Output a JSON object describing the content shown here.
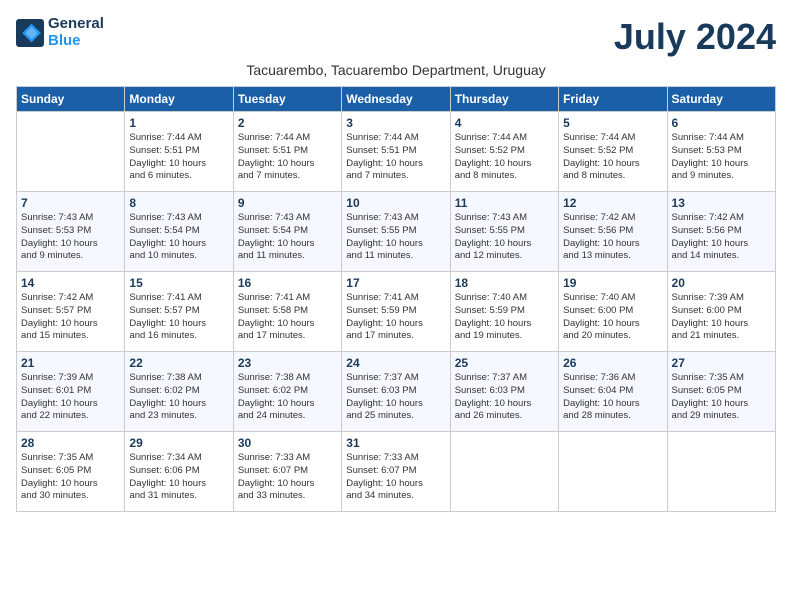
{
  "header": {
    "logo_line1": "General",
    "logo_line2": "Blue",
    "month_year": "July 2024",
    "location": "Tacuarembo, Tacuarembo Department, Uruguay"
  },
  "days_of_week": [
    "Sunday",
    "Monday",
    "Tuesday",
    "Wednesday",
    "Thursday",
    "Friday",
    "Saturday"
  ],
  "weeks": [
    [
      {
        "num": "",
        "info": ""
      },
      {
        "num": "1",
        "info": "Sunrise: 7:44 AM\nSunset: 5:51 PM\nDaylight: 10 hours\nand 6 minutes."
      },
      {
        "num": "2",
        "info": "Sunrise: 7:44 AM\nSunset: 5:51 PM\nDaylight: 10 hours\nand 7 minutes."
      },
      {
        "num": "3",
        "info": "Sunrise: 7:44 AM\nSunset: 5:51 PM\nDaylight: 10 hours\nand 7 minutes."
      },
      {
        "num": "4",
        "info": "Sunrise: 7:44 AM\nSunset: 5:52 PM\nDaylight: 10 hours\nand 8 minutes."
      },
      {
        "num": "5",
        "info": "Sunrise: 7:44 AM\nSunset: 5:52 PM\nDaylight: 10 hours\nand 8 minutes."
      },
      {
        "num": "6",
        "info": "Sunrise: 7:44 AM\nSunset: 5:53 PM\nDaylight: 10 hours\nand 9 minutes."
      }
    ],
    [
      {
        "num": "7",
        "info": "Sunrise: 7:43 AM\nSunset: 5:53 PM\nDaylight: 10 hours\nand 9 minutes."
      },
      {
        "num": "8",
        "info": "Sunrise: 7:43 AM\nSunset: 5:54 PM\nDaylight: 10 hours\nand 10 minutes."
      },
      {
        "num": "9",
        "info": "Sunrise: 7:43 AM\nSunset: 5:54 PM\nDaylight: 10 hours\nand 11 minutes."
      },
      {
        "num": "10",
        "info": "Sunrise: 7:43 AM\nSunset: 5:55 PM\nDaylight: 10 hours\nand 11 minutes."
      },
      {
        "num": "11",
        "info": "Sunrise: 7:43 AM\nSunset: 5:55 PM\nDaylight: 10 hours\nand 12 minutes."
      },
      {
        "num": "12",
        "info": "Sunrise: 7:42 AM\nSunset: 5:56 PM\nDaylight: 10 hours\nand 13 minutes."
      },
      {
        "num": "13",
        "info": "Sunrise: 7:42 AM\nSunset: 5:56 PM\nDaylight: 10 hours\nand 14 minutes."
      }
    ],
    [
      {
        "num": "14",
        "info": "Sunrise: 7:42 AM\nSunset: 5:57 PM\nDaylight: 10 hours\nand 15 minutes."
      },
      {
        "num": "15",
        "info": "Sunrise: 7:41 AM\nSunset: 5:57 PM\nDaylight: 10 hours\nand 16 minutes."
      },
      {
        "num": "16",
        "info": "Sunrise: 7:41 AM\nSunset: 5:58 PM\nDaylight: 10 hours\nand 17 minutes."
      },
      {
        "num": "17",
        "info": "Sunrise: 7:41 AM\nSunset: 5:59 PM\nDaylight: 10 hours\nand 17 minutes."
      },
      {
        "num": "18",
        "info": "Sunrise: 7:40 AM\nSunset: 5:59 PM\nDaylight: 10 hours\nand 19 minutes."
      },
      {
        "num": "19",
        "info": "Sunrise: 7:40 AM\nSunset: 6:00 PM\nDaylight: 10 hours\nand 20 minutes."
      },
      {
        "num": "20",
        "info": "Sunrise: 7:39 AM\nSunset: 6:00 PM\nDaylight: 10 hours\nand 21 minutes."
      }
    ],
    [
      {
        "num": "21",
        "info": "Sunrise: 7:39 AM\nSunset: 6:01 PM\nDaylight: 10 hours\nand 22 minutes."
      },
      {
        "num": "22",
        "info": "Sunrise: 7:38 AM\nSunset: 6:02 PM\nDaylight: 10 hours\nand 23 minutes."
      },
      {
        "num": "23",
        "info": "Sunrise: 7:38 AM\nSunset: 6:02 PM\nDaylight: 10 hours\nand 24 minutes."
      },
      {
        "num": "24",
        "info": "Sunrise: 7:37 AM\nSunset: 6:03 PM\nDaylight: 10 hours\nand 25 minutes."
      },
      {
        "num": "25",
        "info": "Sunrise: 7:37 AM\nSunset: 6:03 PM\nDaylight: 10 hours\nand 26 minutes."
      },
      {
        "num": "26",
        "info": "Sunrise: 7:36 AM\nSunset: 6:04 PM\nDaylight: 10 hours\nand 28 minutes."
      },
      {
        "num": "27",
        "info": "Sunrise: 7:35 AM\nSunset: 6:05 PM\nDaylight: 10 hours\nand 29 minutes."
      }
    ],
    [
      {
        "num": "28",
        "info": "Sunrise: 7:35 AM\nSunset: 6:05 PM\nDaylight: 10 hours\nand 30 minutes."
      },
      {
        "num": "29",
        "info": "Sunrise: 7:34 AM\nSunset: 6:06 PM\nDaylight: 10 hours\nand 31 minutes."
      },
      {
        "num": "30",
        "info": "Sunrise: 7:33 AM\nSunset: 6:07 PM\nDaylight: 10 hours\nand 33 minutes."
      },
      {
        "num": "31",
        "info": "Sunrise: 7:33 AM\nSunset: 6:07 PM\nDaylight: 10 hours\nand 34 minutes."
      },
      {
        "num": "",
        "info": ""
      },
      {
        "num": "",
        "info": ""
      },
      {
        "num": "",
        "info": ""
      }
    ]
  ]
}
